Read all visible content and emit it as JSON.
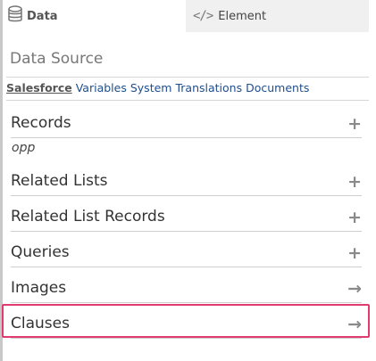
{
  "tabs": {
    "data": {
      "label": "Data",
      "icon": "database-icon"
    },
    "element": {
      "label": "Element",
      "icon": "code-icon",
      "glyph": "</>"
    }
  },
  "panel": {
    "title": "Data Source",
    "subnav": [
      "Salesforce",
      "Variables",
      "System",
      "Translations",
      "Documents"
    ],
    "active_subnav": "Salesforce"
  },
  "sections": {
    "records": {
      "label": "Records",
      "action": "+",
      "items": [
        "opp"
      ]
    },
    "related_lists": {
      "label": "Related Lists",
      "action": "+"
    },
    "related_list_records": {
      "label": "Related List Records",
      "action": "+"
    },
    "queries": {
      "label": "Queries",
      "action": "+"
    },
    "images": {
      "label": "Images",
      "action": "→"
    },
    "clauses": {
      "label": "Clauses",
      "action": "→"
    }
  },
  "colors": {
    "highlight": "#e23c6f",
    "link": "#1e4e8c"
  }
}
